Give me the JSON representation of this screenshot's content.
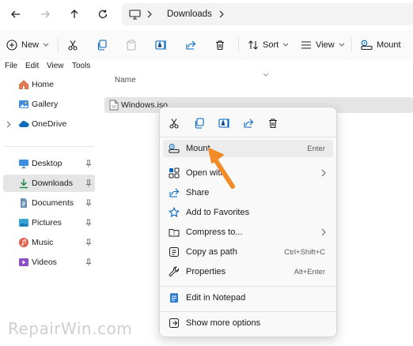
{
  "address": {
    "location": "Downloads"
  },
  "toolbar": {
    "new": "New",
    "sort": "Sort",
    "view": "View",
    "mount": "Mount"
  },
  "menubar": [
    "File",
    "Edit",
    "View",
    "Tools"
  ],
  "nav": {
    "home": "Home",
    "gallery": "Gallery",
    "onedrive": "OneDrive",
    "desktop": "Desktop",
    "downloads": "Downloads",
    "documents": "Documents",
    "pictures": "Pictures",
    "music": "Music",
    "videos": "Videos"
  },
  "content": {
    "column_name": "Name",
    "file": "Windows.iso"
  },
  "context_menu": {
    "items": [
      {
        "label": "Mount",
        "shortcut": "Enter"
      },
      {
        "label": "Open with",
        "shortcut": ""
      },
      {
        "label": "Share",
        "shortcut": ""
      },
      {
        "label": "Add to Favorites",
        "shortcut": ""
      },
      {
        "label": "Compress to...",
        "shortcut": ""
      },
      {
        "label": "Copy as path",
        "shortcut": "Ctrl+Shift+C"
      },
      {
        "label": "Properties",
        "shortcut": "Alt+Enter"
      },
      {
        "label": "Edit in Notepad",
        "shortcut": ""
      },
      {
        "label": "Show more options",
        "shortcut": ""
      }
    ]
  },
  "watermark": "RepairWin.com",
  "colors": {
    "accent": "#0067c0",
    "arrow": "#f28c28",
    "selection": "#e5e5e5"
  }
}
